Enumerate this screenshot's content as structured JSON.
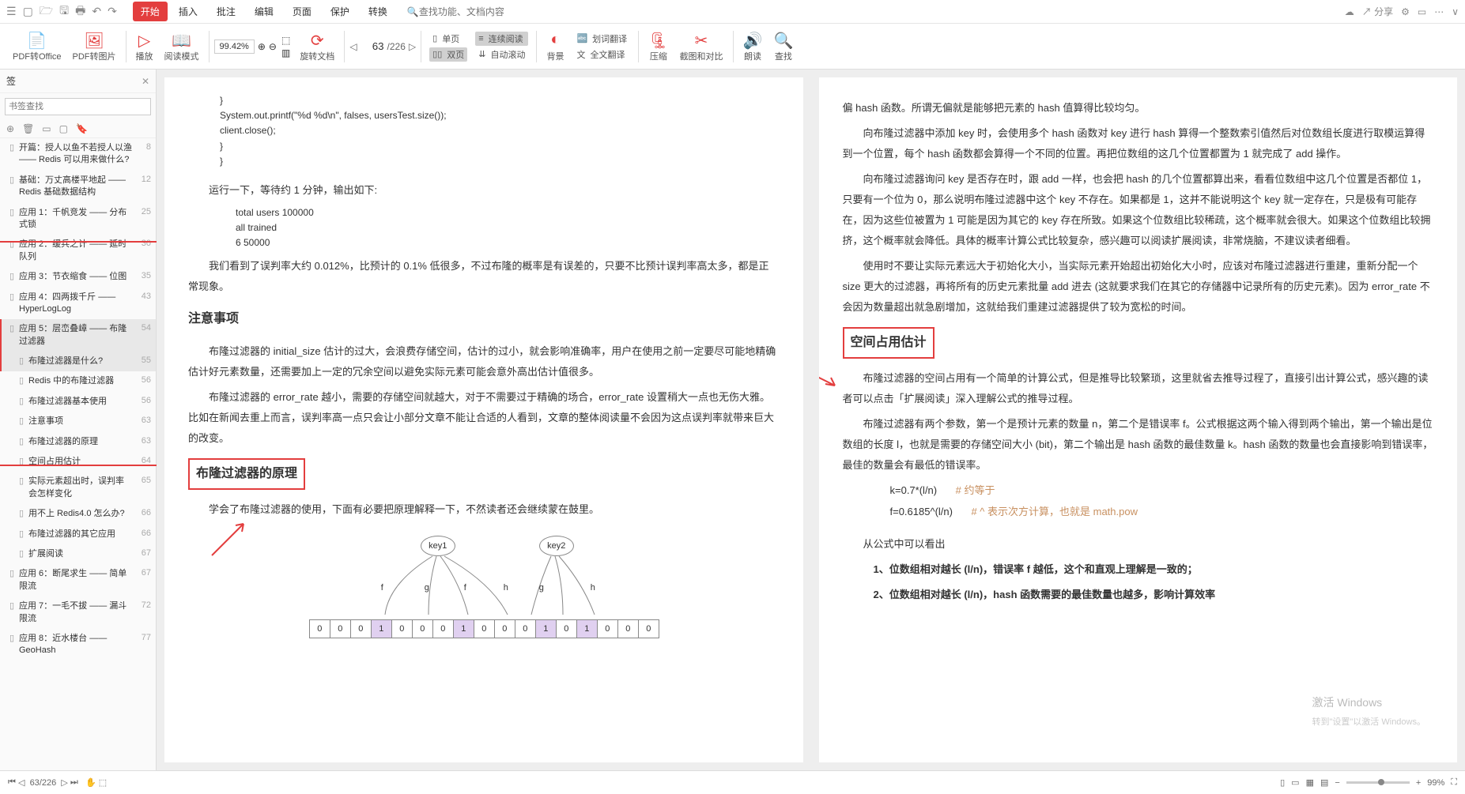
{
  "menubar": {
    "tabs": [
      "开始",
      "插入",
      "批注",
      "编辑",
      "页面",
      "保护",
      "转换"
    ],
    "active_tab": 0,
    "search_placeholder": "查找功能、文档内容",
    "share": "分享"
  },
  "toolbar": {
    "pdf_office": "PDF转Office",
    "pdf_image": "PDF转图片",
    "play": "播放",
    "read_mode": "阅读模式",
    "zoom": "99.42%",
    "rotate": "旋转文档",
    "page_current": "63",
    "page_total": "/226",
    "single": "单页",
    "double": "双页",
    "continuous": "连续阅读",
    "auto_scroll": "自动滚动",
    "background": "背景",
    "huaci": "划词翻译",
    "fulltrans": "全文翻译",
    "compress": "压缩",
    "screenshot": "截图和对比",
    "read_aloud": "朗读",
    "find": "查找"
  },
  "sidebar": {
    "title": "签",
    "search_placeholder": "书签查找",
    "items": [
      {
        "txt": "开篇：授人以鱼不若授人以渔 —— Redis 可以用来做什么?",
        "pg": "8",
        "lvl": 0
      },
      {
        "txt": "基础：万丈高楼平地起 —— Redis 基础数据结构",
        "pg": "12",
        "lvl": 0
      },
      {
        "txt": "应用 1：千帆竞发 —— 分布式锁",
        "pg": "25",
        "lvl": 0
      },
      {
        "txt": "应用 2：缓兵之计 —— 延时队列",
        "pg": "30",
        "lvl": 0
      },
      {
        "txt": "应用 3：节衣缩食 —— 位图",
        "pg": "35",
        "lvl": 0
      },
      {
        "txt": "应用 4：四两拨千斤 —— HyperLogLog",
        "pg": "43",
        "lvl": 0
      },
      {
        "txt": "应用 5：层峦叠嶂 —— 布隆过滤器",
        "pg": "54",
        "lvl": 0,
        "sel": true
      },
      {
        "txt": "布隆过滤器是什么?",
        "pg": "55",
        "lvl": 1,
        "hili": true
      },
      {
        "txt": "Redis 中的布隆过滤器",
        "pg": "56",
        "lvl": 1
      },
      {
        "txt": "布隆过滤器基本使用",
        "pg": "56",
        "lvl": 1
      },
      {
        "txt": "注意事项",
        "pg": "63",
        "lvl": 1
      },
      {
        "txt": "布隆过滤器的原理",
        "pg": "63",
        "lvl": 1
      },
      {
        "txt": "空间占用估计",
        "pg": "64",
        "lvl": 1
      },
      {
        "txt": "实际元素超出时，误判率会怎样变化",
        "pg": "65",
        "lvl": 1
      },
      {
        "txt": "用不上 Redis4.0 怎么办?",
        "pg": "66",
        "lvl": 1
      },
      {
        "txt": "布隆过滤器的其它应用",
        "pg": "66",
        "lvl": 1
      },
      {
        "txt": "扩展阅读",
        "pg": "67",
        "lvl": 1
      },
      {
        "txt": "应用 6：断尾求生 —— 简单限流",
        "pg": "67",
        "lvl": 0
      },
      {
        "txt": "应用 7：一毛不拔 —— 漏斗限流",
        "pg": "72",
        "lvl": 0
      },
      {
        "txt": "应用 8：近水楼台 —— GeoHash",
        "pg": "77",
        "lvl": 0
      }
    ]
  },
  "left_page": {
    "code": [
      "}",
      "System.out.printf(\"%d %d\\n\", falses, usersTest.size());",
      "client.close();",
      "}",
      "}"
    ],
    "run_line": "运行一下，等待约 1 分钟，输出如下:",
    "output": [
      "total users 100000",
      "all trained",
      "6 50000"
    ],
    "para1": "我们看到了误判率大约 0.012%，比预计的 0.1% 低很多，不过布隆的概率是有误差的，只要不比预计误判率高太多，都是正常现象。",
    "h_notes": "注意事项",
    "para2": "布隆过滤器的 initial_size 估计的过大，会浪费存储空间，估计的过小，就会影响准确率，用户在使用之前一定要尽可能地精确估计好元素数量，还需要加上一定的冗余空间以避免实际元素可能会意外高出估计值很多。",
    "para3": "布隆过滤器的 error_rate 越小，需要的存储空间就越大，对于不需要过于精确的场合，error_rate 设置稍大一点也无伤大雅。比如在新闻去重上而言，误判率高一点只会让小部分文章不能让合适的人看到，文章的整体阅读量不会因为这点误判率就带来巨大的改变。",
    "h_principle": "布隆过滤器的原理",
    "para4": "学会了布隆过滤器的使用，下面有必要把原理解释一下，不然读者还会继续蒙在鼓里。",
    "diagram": {
      "key1": "key1",
      "key2": "key2",
      "bits": [
        0,
        0,
        0,
        1,
        0,
        0,
        0,
        1,
        0,
        0,
        0,
        1,
        0,
        1,
        0,
        0,
        0
      ]
    }
  },
  "right_page": {
    "para1": "偏 hash 函数。所谓无偏就是能够把元素的 hash 值算得比较均匀。",
    "para2": "向布隆过滤器中添加 key 时，会使用多个 hash 函数对 key 进行 hash 算得一个整数索引值然后对位数组长度进行取模运算得到一个位置，每个 hash 函数都会算得一个不同的位置。再把位数组的这几个位置都置为 1 就完成了 add 操作。",
    "para3": "向布隆过滤器询问 key 是否存在时，跟 add 一样，也会把 hash 的几个位置都算出来，看看位数组中这几个位置是否都位 1，只要有一个位为 0，那么说明布隆过滤器中这个 key 不存在。如果都是 1，这并不能说明这个 key 就一定存在，只是极有可能存在，因为这些位被置为 1 可能是因为其它的 key 存在所致。如果这个位数组比较稀疏，这个概率就会很大。如果这个位数组比较拥挤，这个概率就会降低。具体的概率计算公式比较复杂，感兴趣可以阅读扩展阅读，非常烧脑，不建议读者细看。",
    "para4": "使用时不要让实际元素远大于初始化大小，当实际元素开始超出初始化大小时，应该对布隆过滤器进行重建，重新分配一个 size 更大的过滤器，再将所有的历史元素批量 add 进去 (这就要求我们在其它的存储器中记录所有的历史元素)。因为 error_rate 不会因为数量超出就急剧增加，这就给我们重建过滤器提供了较为宽松的时间。",
    "h_space": "空间占用估计",
    "para5": "布隆过滤器的空间占用有一个简单的计算公式，但是推导比较繁琐，这里就省去推导过程了，直接引出计算公式，感兴趣的读者可以点击「扩展阅读」深入理解公式的推导过程。",
    "para6": "布隆过滤器有两个参数，第一个是预计元素的数量 n，第二个是错误率 f。公式根据这两个输入得到两个输出，第一个输出是位数组的长度 l，也就是需要的存储空间大小 (bit)，第二个输出是 hash 函数的最佳数量 k。hash 函数的数量也会直接影响到错误率，最佳的数量会有最低的错误率。",
    "formula1": "k=0.7*(l/n)",
    "formula1_c": "# 约等于",
    "formula2": "f=0.6185^(l/n)",
    "formula2_c": "# ^ 表示次方计算，也就是 math.pow",
    "para7": "从公式中可以看出",
    "li1": "1、位数组相对越长 (l/n)，错误率 f 越低，这个和直观上理解是一致的；",
    "li2": "2、位数组相对越长 (l/n)，hash 函数需要的最佳数量也越多，影响计算效率"
  },
  "statusbar": {
    "page": "63",
    "total": "/226",
    "zoom": "99%",
    "watermark1": "转到\"设置\"以激活 Windows。",
    "watermark0": "激活 Windows"
  }
}
